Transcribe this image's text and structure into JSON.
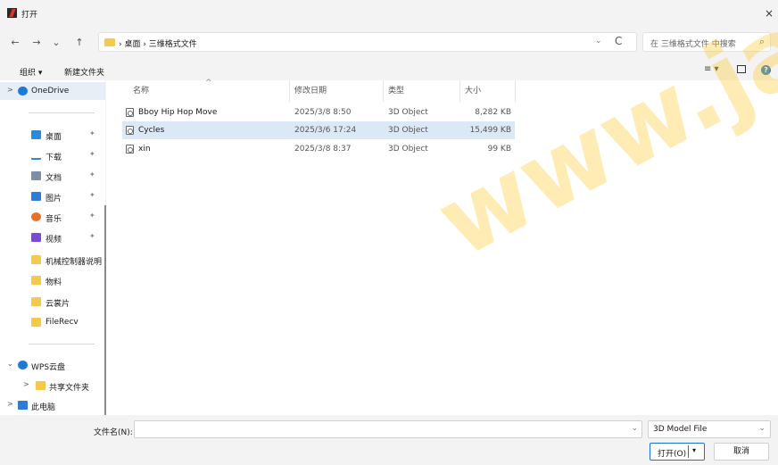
{
  "window": {
    "title": "打开",
    "close_glyph": "×"
  },
  "nav": {
    "back": "←",
    "forward": "→",
    "recent": "⌄",
    "up": "↑",
    "breadcrumb": "› 桌面 › 三维格式文件",
    "refresh": "C",
    "search_placeholder": "在 三维格式文件 中搜索",
    "search_icon": "search-icon"
  },
  "toolbar": {
    "organize": "组织 ▾",
    "new_folder": "新建文件夹",
    "view_glyph": "≡ ▾",
    "help": "?"
  },
  "sidebar": {
    "items": [
      {
        "label": "OneDrive",
        "arrow": ">",
        "icon": "cloud-icon",
        "color": "#1e7ad6"
      },
      {
        "label": "桌面",
        "pin": "✦",
        "icon": "desktop-icon",
        "color": "#2d8ad8"
      },
      {
        "label": "下载",
        "pin": "✦",
        "icon": "download-icon",
        "color": "#2d8ad8"
      },
      {
        "label": "文档",
        "pin": "✦",
        "icon": "document-icon",
        "color": "#7d8fa8"
      },
      {
        "label": "图片",
        "pin": "✦",
        "icon": "picture-icon",
        "color": "#2d7dd2"
      },
      {
        "label": "音乐",
        "pin": "✦",
        "icon": "music-icon",
        "color": "#e8702a"
      },
      {
        "label": "视频",
        "pin": "✦",
        "icon": "video-icon",
        "color": "#7a4ad8"
      },
      {
        "label": "机械控制器说明",
        "icon": "folder-icon",
        "color": "#f6c94a"
      },
      {
        "label": "物料",
        "icon": "folder-icon",
        "color": "#f6c94a"
      },
      {
        "label": "云裳片",
        "icon": "folder-icon",
        "color": "#f6c94a"
      },
      {
        "label": "FileRecv",
        "icon": "folder-icon",
        "color": "#f6c94a"
      },
      {
        "label": "WPS云盘",
        "arrow": "⌄",
        "icon": "cloud-icon",
        "color": "#1e7ad6"
      },
      {
        "label": "共享文件夹",
        "arrow": ">",
        "icon": "shared-folder-icon",
        "color": "#f6c94a"
      },
      {
        "label": "此电脑",
        "arrow": ">",
        "icon": "computer-icon",
        "color": "#2d7dd2"
      }
    ]
  },
  "columns": {
    "name": "名称",
    "date": "修改日期",
    "type": "类型",
    "size": "大小",
    "sort_caret": "^"
  },
  "files": [
    {
      "name": "Bboy Hip Hop Move",
      "date": "2025/3/8 8:50",
      "type": "3D Object",
      "size": "8,282 KB"
    },
    {
      "name": "Cycles",
      "date": "2025/3/6 17:24",
      "type": "3D Object",
      "size": "15,499 KB",
      "selected": true
    },
    {
      "name": "xin",
      "date": "2025/3/8 8:37",
      "type": "3D Object",
      "size": "99 KB"
    }
  ],
  "watermark": "www.jad-l",
  "bottom": {
    "filename_label": "文件名(N):",
    "filename_value": "",
    "filetype": "3D Model File",
    "open_label": "打开(O)",
    "open_arrow": "▾",
    "cancel_label": "取消"
  }
}
